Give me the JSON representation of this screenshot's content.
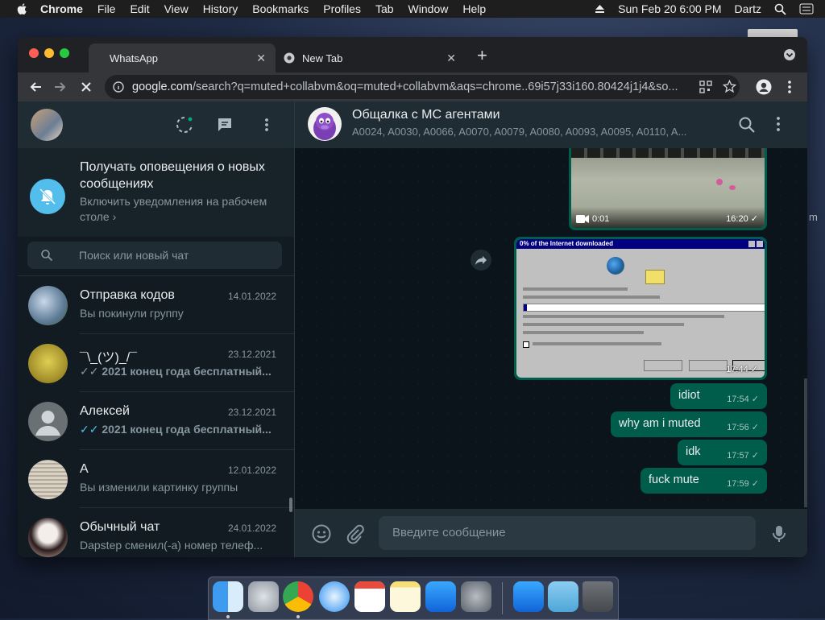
{
  "menubar": {
    "app": "Chrome",
    "items": [
      "File",
      "Edit",
      "View",
      "History",
      "Bookmarks",
      "Profiles",
      "Tab",
      "Window",
      "Help"
    ],
    "datetime": "Sun Feb 20  6:00 PM",
    "user": "Dartz"
  },
  "browser": {
    "tabs": [
      {
        "title": "WhatsApp",
        "active": true
      },
      {
        "title": "New Tab",
        "active": false
      }
    ],
    "url_host": "google.com",
    "url_rest": "/search?q=muted+collabvm&oq=muted+collabvm&aqs=chrome..69i57j33i160.80424j1j4&so..."
  },
  "whatsapp": {
    "notification": {
      "title": "Получать оповещения о новых сообщениях",
      "subtitle": "Включить уведомления на рабочем столе ›"
    },
    "search_placeholder": "Поиск или новый чат",
    "chats": [
      {
        "name": "Отправка кодов",
        "date": "14.01.2022",
        "preview": "Вы покинули группу",
        "avatar_color": "#6f8fae"
      },
      {
        "name": "¯\\_(ツ)_/¯",
        "date": "23.12.2021",
        "preview": "2021 конец года бесплатный...",
        "ticks": "✓✓",
        "avatar_color": "#b8a33c"
      },
      {
        "name": "Алексей",
        "date": "23.12.2021",
        "preview": "2021 конец года бесплатный...",
        "ticks": "✓✓",
        "avatar_color": "#6a7175"
      },
      {
        "name": "А",
        "date": "12.01.2022",
        "preview": "Вы изменили картинку группы",
        "avatar_color": "#c8c0b2"
      },
      {
        "name": "Обычный чат",
        "date": "24.01.2022",
        "preview": "Dapstep сменил(-а) номер телеф...",
        "avatar_color": "#e7dcd8"
      }
    ],
    "conversation": {
      "name": "Общалка с МС агентами",
      "members": "A0024, A0030, A0066, A0070, A0079, A0080, A0093, A0095, A0110, A..."
    },
    "media": [
      {
        "duration": "0:01",
        "time": "16:20 ✓"
      },
      {
        "caption_title": "0% of the Internet downloaded",
        "time": "17:44 ✓"
      }
    ],
    "messages": [
      {
        "text": "idiot",
        "time": "17:54 ✓"
      },
      {
        "text": "why am i muted",
        "time": "17:56 ✓"
      },
      {
        "text": "idk",
        "time": "17:57 ✓"
      },
      {
        "text": "fuck mute",
        "time": "17:59 ✓"
      }
    ],
    "input_placeholder": "Введите сообщение"
  },
  "colors": {
    "accent_green": "#005c4b",
    "blue_ticks": "#53bdeb"
  }
}
